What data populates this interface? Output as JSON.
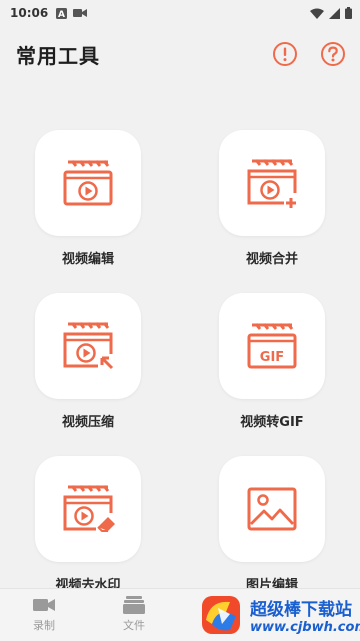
{
  "status_bar": {
    "time": "10:06"
  },
  "header": {
    "title": "常用工具",
    "info_icon": "exclamation-circle-icon",
    "help_icon": "question-circle-icon"
  },
  "accent_color": "#ef6a4a",
  "tools": [
    {
      "label": "视频编辑",
      "icon": "video-clapper-play-icon"
    },
    {
      "label": "视频合并",
      "icon": "video-clapper-plus-icon"
    },
    {
      "label": "视频压缩",
      "icon": "video-clapper-compress-icon"
    },
    {
      "label": "视频转GIF",
      "icon": "gif-clapper-icon",
      "badge": "GIF"
    },
    {
      "label": "视频去水印",
      "icon": "video-clapper-eraser-icon"
    },
    {
      "label": "图片编辑",
      "icon": "image-icon"
    }
  ],
  "bottom_nav": [
    {
      "label": "录制",
      "icon": "video-camera-icon"
    },
    {
      "label": "文件",
      "icon": "folder-stack-icon"
    }
  ],
  "watermark": {
    "main": "超级棒下载站",
    "url": "www.cjbwh.com"
  }
}
